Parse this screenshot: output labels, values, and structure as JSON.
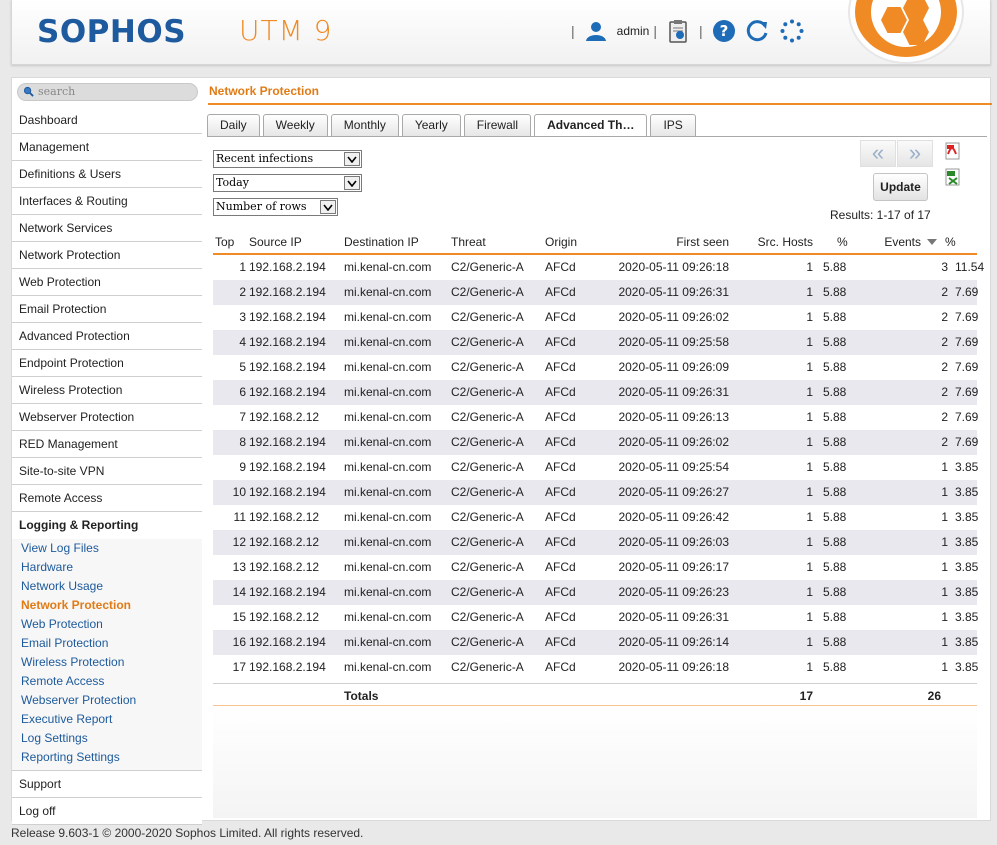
{
  "header": {
    "brand": "SOPHOS",
    "product": "UTM 9",
    "user": "admin",
    "icons": [
      "user-icon",
      "clipboard-icon",
      "help-icon",
      "refresh-icon",
      "spinner-icon"
    ]
  },
  "sidebar": {
    "search_placeholder": "search",
    "items": [
      "Dashboard",
      "Management",
      "Definitions & Users",
      "Interfaces & Routing",
      "Network Services",
      "Network Protection",
      "Web Protection",
      "Email Protection",
      "Advanced Protection",
      "Endpoint Protection",
      "Wireless Protection",
      "Webserver Protection",
      "RED Management",
      "Site-to-site VPN",
      "Remote Access"
    ],
    "group": {
      "label": "Logging & Reporting",
      "subitems": [
        "View Log Files",
        "Hardware",
        "Network Usage",
        "Network Protection",
        "Web Protection",
        "Email Protection",
        "Wireless Protection",
        "Remote Access",
        "Webserver Protection",
        "Executive Report",
        "Log Settings",
        "Reporting Settings"
      ],
      "active": "Network Protection"
    },
    "bottom_items": [
      "Support",
      "Log off"
    ]
  },
  "content": {
    "title": "Network Protection",
    "tabs": [
      "Daily",
      "Weekly",
      "Monthly",
      "Yearly",
      "Firewall",
      "Advanced Th…",
      "IPS"
    ],
    "active_tab": "Advanced Th…",
    "selects": [
      "Recent infections",
      "Today",
      "Number of rows"
    ],
    "pager": {
      "prev": "«",
      "next": "»"
    },
    "update_label": "Update",
    "results": "Results: 1-17 of 17"
  },
  "table": {
    "headers": {
      "top": "Top",
      "source": "Source IP",
      "destination": "Destination IP",
      "threat": "Threat",
      "origin": "Origin",
      "first_seen": "First seen",
      "src_hosts": "Src. Hosts",
      "hosts_pct": "%",
      "events": "Events",
      "events_pct": "%"
    },
    "rows": [
      [
        "1",
        "192.168.2.194",
        "mi.kenal-cn.com",
        "C2/Generic-A",
        "AFCd",
        "2020-05-11 09:26:18",
        "1",
        "5.88",
        "3",
        "11.54"
      ],
      [
        "2",
        "192.168.2.194",
        "mi.kenal-cn.com",
        "C2/Generic-A",
        "AFCd",
        "2020-05-11 09:26:31",
        "1",
        "5.88",
        "2",
        "7.69"
      ],
      [
        "3",
        "192.168.2.194",
        "mi.kenal-cn.com",
        "C2/Generic-A",
        "AFCd",
        "2020-05-11 09:26:02",
        "1",
        "5.88",
        "2",
        "7.69"
      ],
      [
        "4",
        "192.168.2.194",
        "mi.kenal-cn.com",
        "C2/Generic-A",
        "AFCd",
        "2020-05-11 09:25:58",
        "1",
        "5.88",
        "2",
        "7.69"
      ],
      [
        "5",
        "192.168.2.194",
        "mi.kenal-cn.com",
        "C2/Generic-A",
        "AFCd",
        "2020-05-11 09:26:09",
        "1",
        "5.88",
        "2",
        "7.69"
      ],
      [
        "6",
        "192.168.2.194",
        "mi.kenal-cn.com",
        "C2/Generic-A",
        "AFCd",
        "2020-05-11 09:26:31",
        "1",
        "5.88",
        "2",
        "7.69"
      ],
      [
        "7",
        "192.168.2.12",
        "mi.kenal-cn.com",
        "C2/Generic-A",
        "AFCd",
        "2020-05-11 09:26:13",
        "1",
        "5.88",
        "2",
        "7.69"
      ],
      [
        "8",
        "192.168.2.194",
        "mi.kenal-cn.com",
        "C2/Generic-A",
        "AFCd",
        "2020-05-11 09:26:02",
        "1",
        "5.88",
        "2",
        "7.69"
      ],
      [
        "9",
        "192.168.2.194",
        "mi.kenal-cn.com",
        "C2/Generic-A",
        "AFCd",
        "2020-05-11 09:25:54",
        "1",
        "5.88",
        "1",
        "3.85"
      ],
      [
        "10",
        "192.168.2.194",
        "mi.kenal-cn.com",
        "C2/Generic-A",
        "AFCd",
        "2020-05-11 09:26:27",
        "1",
        "5.88",
        "1",
        "3.85"
      ],
      [
        "11",
        "192.168.2.12",
        "mi.kenal-cn.com",
        "C2/Generic-A",
        "AFCd",
        "2020-05-11 09:26:42",
        "1",
        "5.88",
        "1",
        "3.85"
      ],
      [
        "12",
        "192.168.2.12",
        "mi.kenal-cn.com",
        "C2/Generic-A",
        "AFCd",
        "2020-05-11 09:26:03",
        "1",
        "5.88",
        "1",
        "3.85"
      ],
      [
        "13",
        "192.168.2.12",
        "mi.kenal-cn.com",
        "C2/Generic-A",
        "AFCd",
        "2020-05-11 09:26:17",
        "1",
        "5.88",
        "1",
        "3.85"
      ],
      [
        "14",
        "192.168.2.194",
        "mi.kenal-cn.com",
        "C2/Generic-A",
        "AFCd",
        "2020-05-11 09:26:23",
        "1",
        "5.88",
        "1",
        "3.85"
      ],
      [
        "15",
        "192.168.2.12",
        "mi.kenal-cn.com",
        "C2/Generic-A",
        "AFCd",
        "2020-05-11 09:26:31",
        "1",
        "5.88",
        "1",
        "3.85"
      ],
      [
        "16",
        "192.168.2.194",
        "mi.kenal-cn.com",
        "C2/Generic-A",
        "AFCd",
        "2020-05-11 09:26:14",
        "1",
        "5.88",
        "1",
        "3.85"
      ],
      [
        "17",
        "192.168.2.194",
        "mi.kenal-cn.com",
        "C2/Generic-A",
        "AFCd",
        "2020-05-11 09:26:18",
        "1",
        "5.88",
        "1",
        "3.85"
      ]
    ],
    "totals": {
      "label": "Totals",
      "src_hosts": "17",
      "events": "26"
    }
  },
  "footer": "Release 9.603-1  © 2000-2020 Sophos Limited. All rights reserved.",
  "colors": {
    "brand_blue": "#1e5a9e",
    "accent_orange": "#f08a24",
    "link_blue": "#1d5a9b"
  }
}
